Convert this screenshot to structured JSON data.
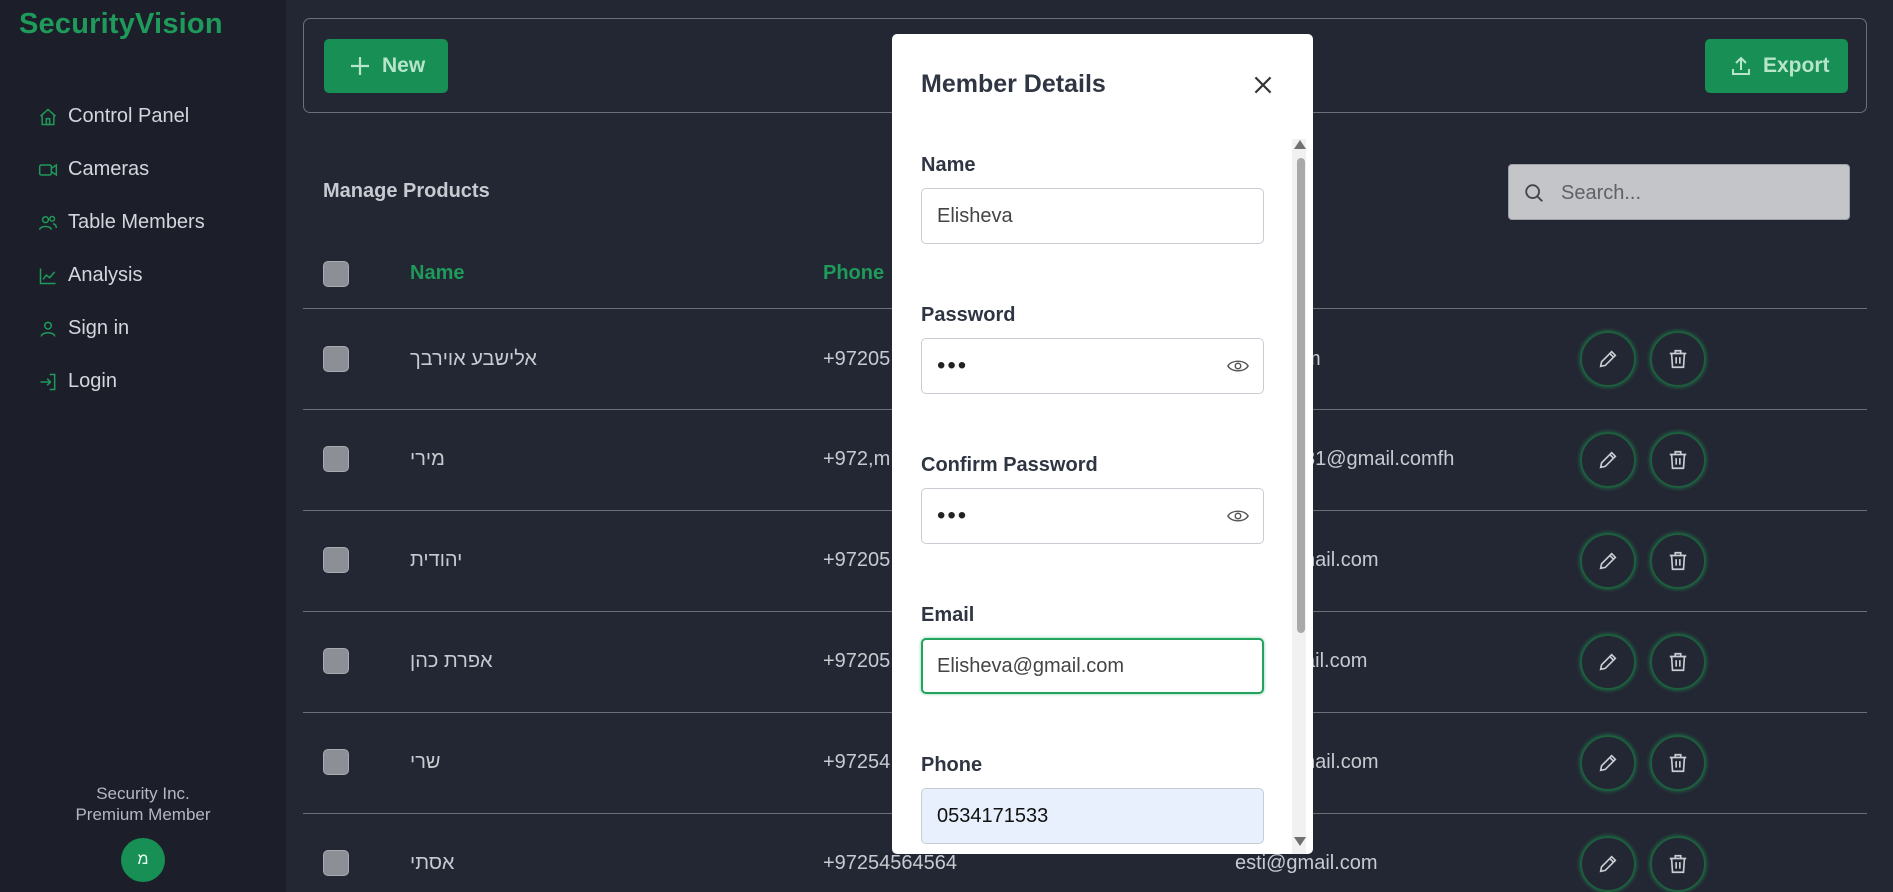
{
  "sidebar": {
    "brand": "SecurityVision",
    "items": [
      {
        "label": "Control Panel",
        "icon": "home-icon"
      },
      {
        "label": "Cameras",
        "icon": "video-camera-icon"
      },
      {
        "label": "Table Members",
        "icon": "users-icon"
      },
      {
        "label": "Analysis",
        "icon": "chart-line-icon"
      },
      {
        "label": "Sign in",
        "icon": "user-icon"
      },
      {
        "label": "Login",
        "icon": "login-icon"
      }
    ],
    "company": "Security Inc.",
    "membership": "Premium Member",
    "avatar_initial": "מ"
  },
  "toolbar": {
    "new_label": "New",
    "export_label": "Export"
  },
  "main": {
    "title": "Manage Products",
    "search_placeholder": "Search...",
    "columns": [
      "Name",
      "Phone"
    ],
    "rows": [
      {
        "name": "אלישבע אוירבך",
        "phone": "+97205",
        "email": "m"
      },
      {
        "name": "מירי",
        "phone": "+972,m",
        "email": "31@gmail.comfh"
      },
      {
        "name": "יהודית",
        "phone": "+97205",
        "email": "nail.com"
      },
      {
        "name": "אפרת כהן",
        "phone": "+97205",
        "email": "ail.com"
      },
      {
        "name": "שרי",
        "phone": "+97254",
        "email": "nail.com"
      },
      {
        "name": "אסתי",
        "phone": "+97254564564",
        "email": "esti@gmail.com"
      }
    ]
  },
  "modal": {
    "title": "Member Details",
    "fields": {
      "name": {
        "label": "Name",
        "value": "Elisheva"
      },
      "password": {
        "label": "Password",
        "value": "•••"
      },
      "confirm_password": {
        "label": "Confirm Password",
        "value": "•••"
      },
      "email": {
        "label": "Email",
        "value": "Elisheva@gmail.com"
      },
      "phone": {
        "label": "Phone",
        "value": "0534171533"
      }
    }
  },
  "colors": {
    "accent": "#178f55",
    "brand": "#1e9a5a",
    "background": "#232733",
    "sidebar": "#1c1f29"
  }
}
